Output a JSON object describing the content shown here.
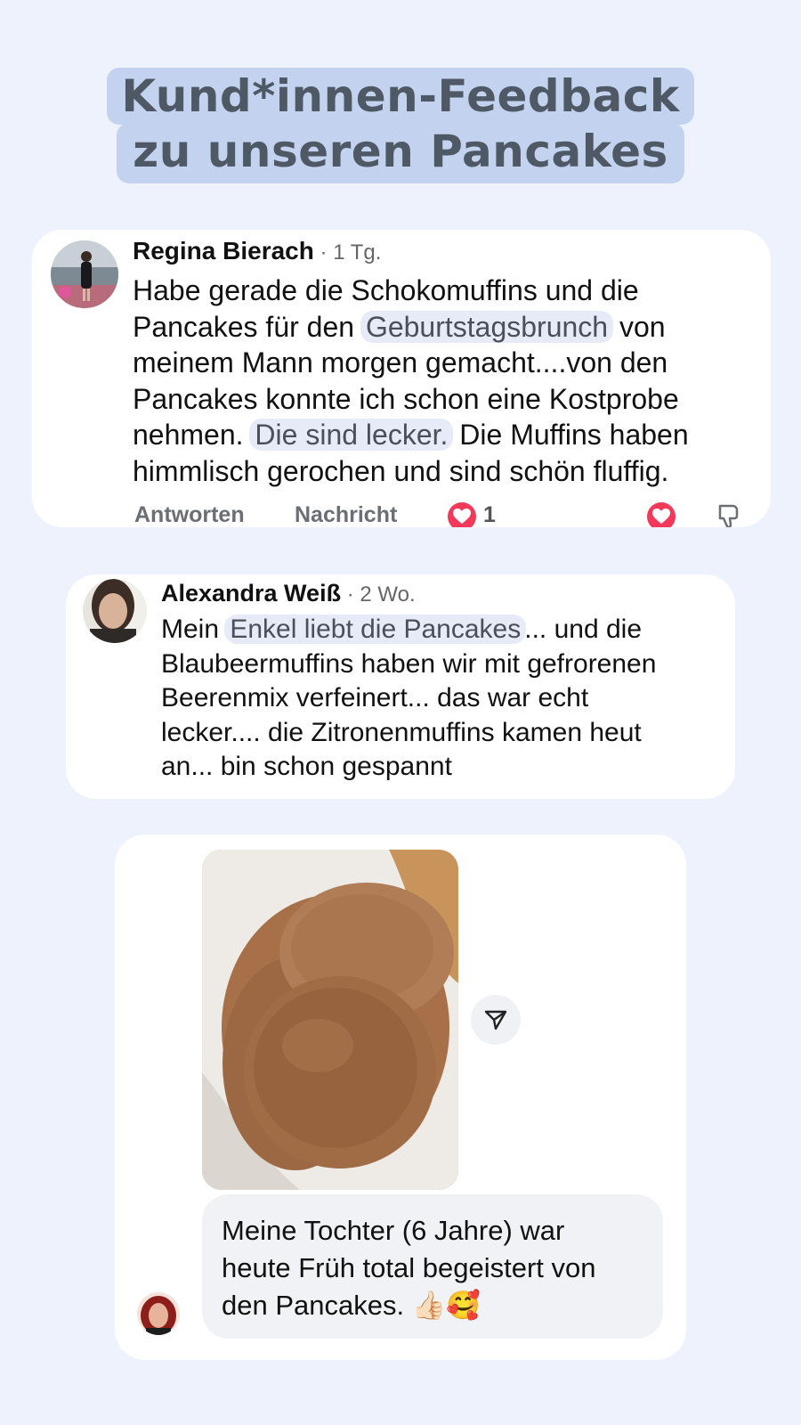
{
  "title": {
    "line1": "Kund*innen-Feedback",
    "line2": "zu unseren Pancakes"
  },
  "comments": [
    {
      "author": "Regina Bierach",
      "time": " · 1 Tg.",
      "text_parts": {
        "p1": "Habe gerade die Schokomuffins und die",
        "p2": "Pancakes für den ",
        "hl1": "Geburtstagsbrunch",
        "p3": " von",
        "p4": "meinem Mann morgen gemacht....von den",
        "p5": "Pancakes konnte ich schon eine Kostprobe",
        "p6": "nehmen. ",
        "hl2": "Die sind lecker.",
        "p7": " Die Muffins haben",
        "p8": "himmlisch gerochen und sind schön fluffig."
      },
      "actions": {
        "reply": "Antworten",
        "message": "Nachricht",
        "like_count": "1"
      }
    },
    {
      "author": "Alexandra Weiß",
      "time": " · 2 Wo.",
      "text_parts": {
        "p1": "Mein ",
        "hl1": "Enkel liebt die Pancakes",
        "p2": "... und die",
        "p3": "Blaubeermuffins haben wir mit gefrorenen",
        "p4": "Beerenmix verfeinert... das war echt",
        "p5": "lecker.... die Zitronenmuffins kamen heut",
        "p6": "an... bin schon gespannt"
      }
    }
  ],
  "message": {
    "line1": "Meine Tochter (6 Jahre) war",
    "line2": "heute Früh total begeistert von",
    "line3": "den Pancakes. 👍🏻🥰"
  },
  "icons": {
    "heart": "heart-icon",
    "dislike": "thumbs-down-icon",
    "send": "send-icon"
  },
  "colors": {
    "background": "#eef2fd",
    "title_highlight": "#c3d3ef",
    "text_highlight": "#e7ebf7",
    "heart": "#f4385a"
  }
}
